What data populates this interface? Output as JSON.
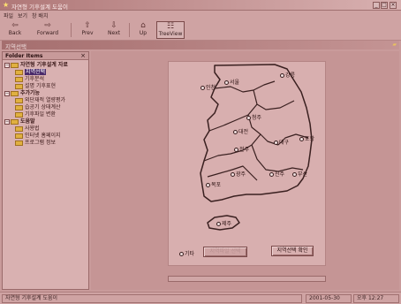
{
  "window": {
    "title": "자연형 기후설계 도움이",
    "controls": [
      "_",
      "□",
      "×"
    ]
  },
  "menu": [
    "파일",
    "보기",
    "창 배치"
  ],
  "toolbar": [
    {
      "label": "Back",
      "icon": "back-arrow-icon",
      "glyph": "⇦",
      "has_dropdown": true
    },
    {
      "label": "Forward",
      "icon": "forward-arrow-icon",
      "glyph": "⇨",
      "has_dropdown": true
    },
    {
      "label": "Prev",
      "icon": "prev-icon",
      "glyph": "⇧"
    },
    {
      "label": "Next",
      "icon": "next-icon",
      "glyph": "⇩"
    },
    {
      "label": "Up",
      "icon": "up-folder-icon",
      "glyph": "⌂"
    },
    {
      "label": "TreeView",
      "icon": "treeview-icon",
      "glyph": "☷",
      "active": true
    }
  ],
  "address": {
    "text": "지역선택"
  },
  "folder_panel": {
    "title": "Folder Items",
    "close": "×",
    "items": [
      {
        "label": "자연형 기후설계 자료",
        "level": 0,
        "group": true,
        "toggle": "−"
      },
      {
        "label": "지역선택",
        "level": 1,
        "selected": true
      },
      {
        "label": "기후분석",
        "level": 1
      },
      {
        "label": "설명 기후표현",
        "level": 1
      },
      {
        "label": "추가기능",
        "level": 0,
        "group": true,
        "toggle": "−"
      },
      {
        "label": "외단재적 열량평가",
        "level": 1
      },
      {
        "label": "습공기 상태계산",
        "level": 1
      },
      {
        "label": "기후파일 변환",
        "level": 1
      },
      {
        "label": "도움말",
        "level": 0,
        "group": true,
        "toggle": "−"
      },
      {
        "label": "사용법",
        "level": 1
      },
      {
        "label": "인터넷 홈페이지",
        "level": 1
      },
      {
        "label": "프로그램 정보",
        "level": 1
      }
    ]
  },
  "map": {
    "cities": [
      {
        "name": "강릉"
      },
      {
        "name": "인천"
      },
      {
        "name": "서울"
      },
      {
        "name": "청주"
      },
      {
        "name": "대전"
      },
      {
        "name": "포항"
      },
      {
        "name": "대구"
      },
      {
        "name": "전주"
      },
      {
        "name": "광주"
      },
      {
        "name": "진주"
      },
      {
        "name": "부산"
      },
      {
        "name": "목포"
      },
      {
        "name": "제주"
      }
    ],
    "other_label": "기타",
    "other_button": "지역파일 선택",
    "confirm_button": "지역선택 확인",
    "colors": {
      "land": "#d8afaf",
      "border": "#3a2020",
      "panel": "#d8afaf"
    }
  },
  "status": {
    "left": "자연형 기후설계 도움이",
    "date": "2001-05-30",
    "time": "오후 12:27"
  }
}
